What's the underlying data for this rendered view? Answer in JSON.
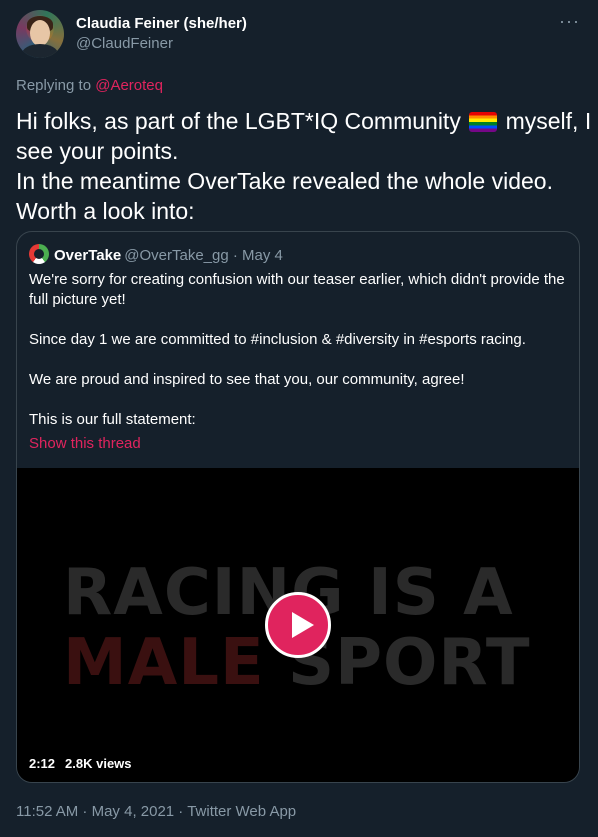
{
  "author": {
    "name": "Claudia Feiner (she/her)",
    "handle": "@ClaudFeiner"
  },
  "more_icon": "···",
  "replying": {
    "prefix": "Replying to ",
    "mention": "@Aeroteq"
  },
  "tweet": {
    "line1_before_flag": "Hi folks, as part of the LGBT*IQ Community ",
    "flag_icon": "rainbow-flag",
    "line1_after_flag": " myself, I",
    "line2": "see your points.",
    "line3": "In the meantime OverTake revealed the whole video.",
    "line4": "Worth a look into:"
  },
  "quoted": {
    "name": "OverTake",
    "handle": "@OverTake_gg · May 4",
    "p1": "We're sorry for creating confusion with our teaser earlier, which didn't provide the full picture yet!",
    "p2": "Since day 1 we are committed to #inclusion & #diversity in #esports racing.",
    "p3": "We are proud and inspired to see that you, our community, agree!",
    "p4": "This is our full statement:",
    "show_thread": "Show this thread",
    "video": {
      "line1": "RACING IS A",
      "line2_red": "MALE",
      "line2_grey": " SPORT",
      "duration": "2:12",
      "views": "2.8K views"
    }
  },
  "meta": "11:52 AM · May 4, 2021 · Twitter Web App",
  "colors": {
    "background": "#15202b",
    "accent": "#e0245e",
    "secondary_text": "#8899a6",
    "border": "#38444d"
  }
}
